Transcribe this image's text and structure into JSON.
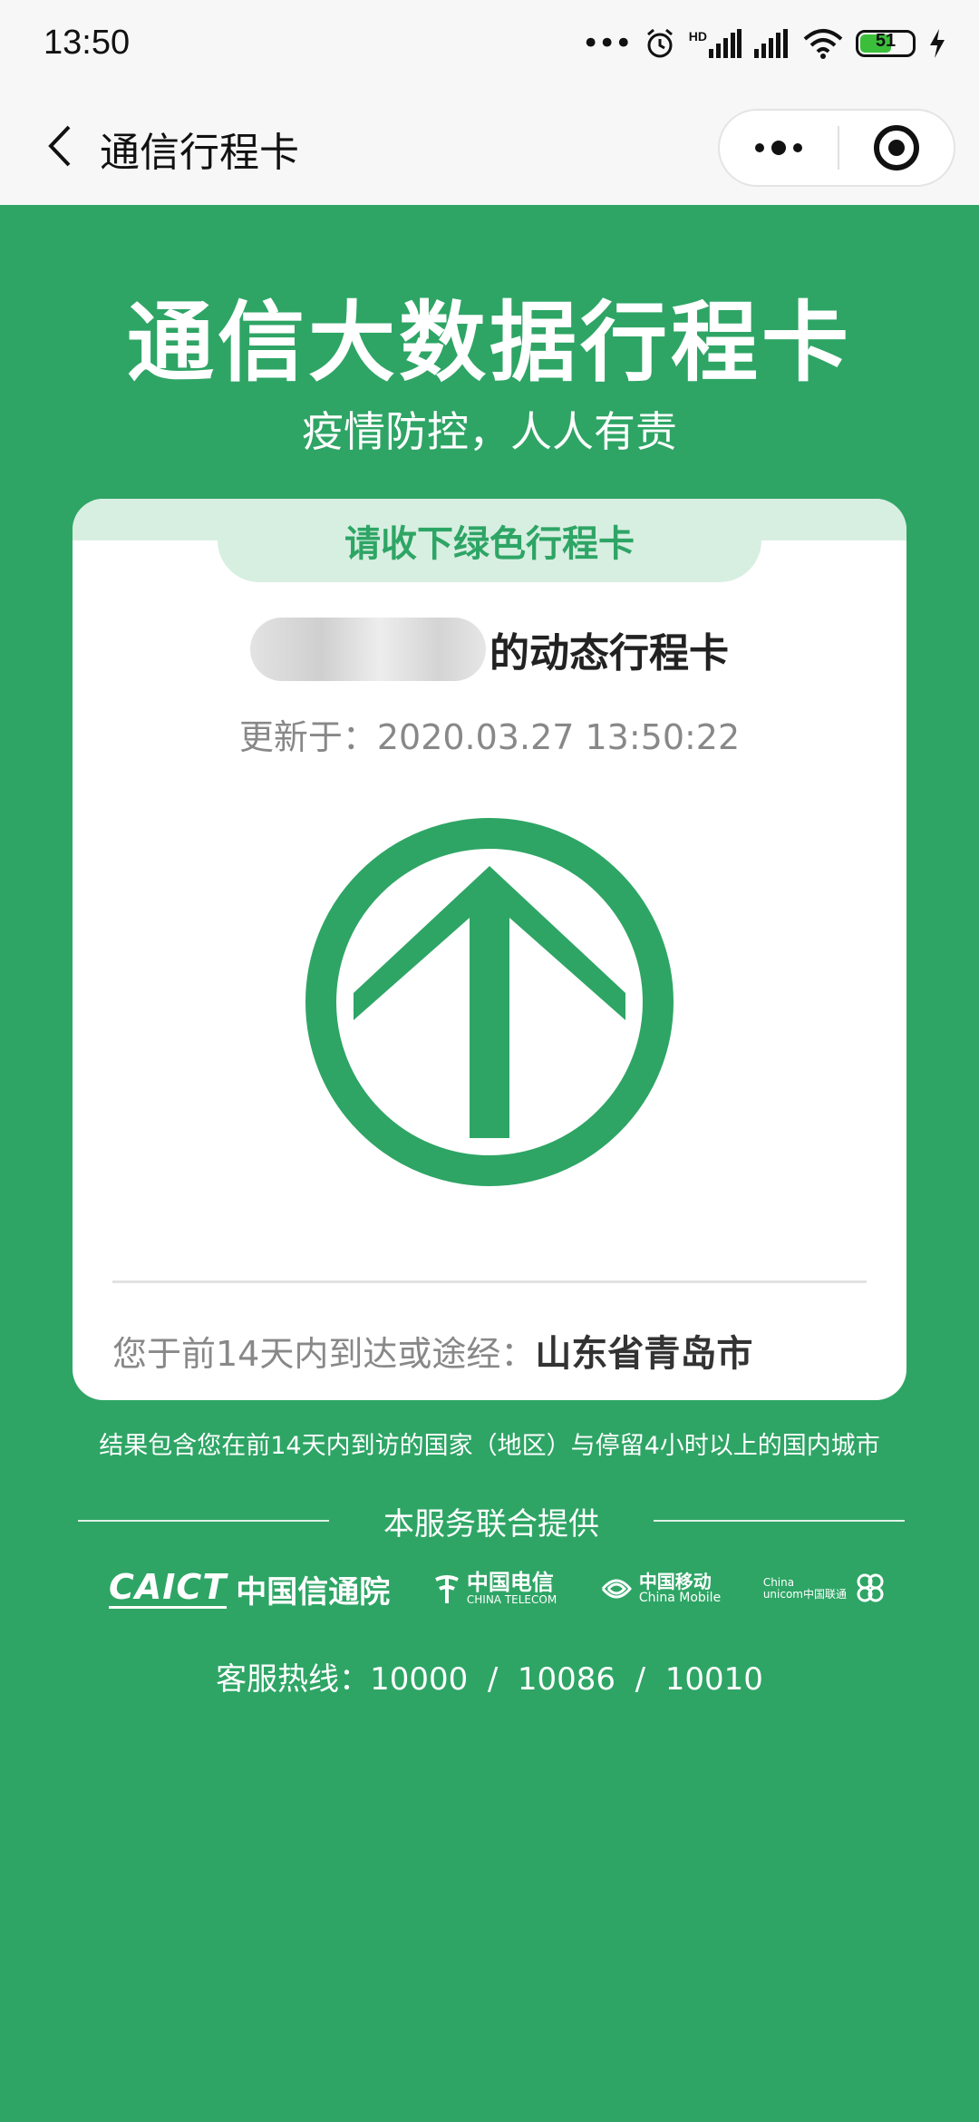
{
  "status_bar": {
    "time": "13:50",
    "hd_label": "HD",
    "battery_level": "51",
    "icons": [
      "dots-icon",
      "alarm-icon",
      "signal-icon",
      "signal-icon",
      "wifi-icon",
      "battery-icon",
      "charging-icon"
    ]
  },
  "nav": {
    "title": "通信行程卡",
    "icons": [
      "back-icon",
      "more-icon",
      "close-miniprogram-icon"
    ]
  },
  "header": {
    "title": "通信大数据行程卡",
    "subtitle": "疫情防控，人人有责"
  },
  "card": {
    "tab_label": "请收下绿色行程卡",
    "name_suffix": "的动态行程卡",
    "update_prefix": "更新于：",
    "update_time": "2020.03.27 13:50:22",
    "status_icon": "green-arrow-up-icon",
    "status_color": "#2ea565",
    "route_prefix": "您于前14天内到达或途经：",
    "route_city": "山东省青岛市"
  },
  "footer": {
    "note": "结果包含您在前14天内到访的国家（地区）与停留4小时以上的国内城市",
    "provider_label": "本服务联合提供",
    "logos": {
      "caict_mark": "CAICT",
      "caict_name": "中国信通院",
      "telecom_cn": "中国电信",
      "telecom_en": "CHINA TELECOM",
      "mobile_cn": "中国移动",
      "mobile_en": "China Mobile",
      "unicom_en1": "China",
      "unicom_en2": "unicom中国联通"
    },
    "hotline_label": "客服热线：",
    "hotline_numbers": "10000  /  10086  /  10010"
  },
  "colors": {
    "brand_green": "#2ea565",
    "tab_bg": "#d7efe1"
  }
}
